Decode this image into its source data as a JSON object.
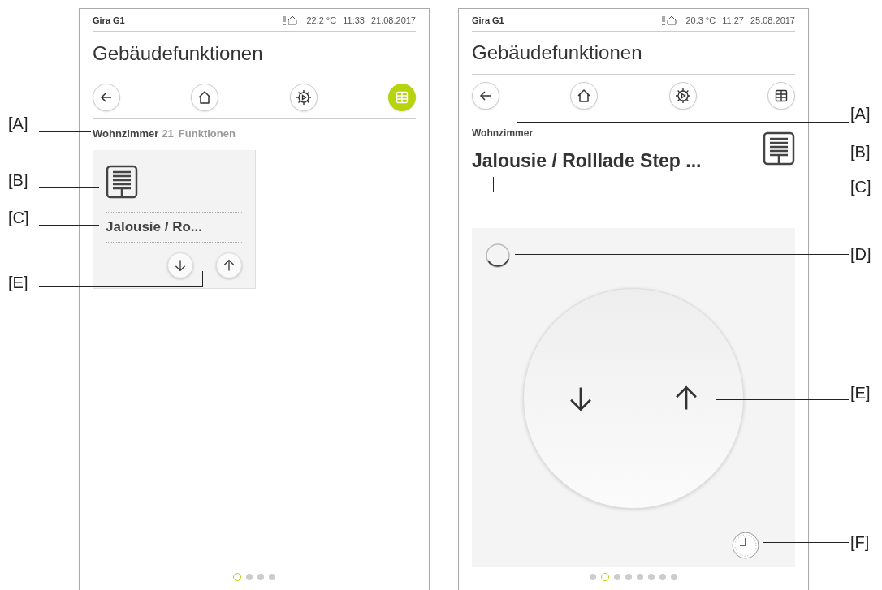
{
  "screens": [
    {
      "kind": "overview",
      "device": "Gira G1",
      "status": {
        "temperature": "22.2 °C",
        "time": "11:33",
        "date": "21.08.2017"
      },
      "title": "Gebäudefunktionen",
      "nav": [
        {
          "kind": "back",
          "selected": false
        },
        {
          "kind": "home",
          "selected": false
        },
        {
          "kind": "scenes",
          "selected": false
        },
        {
          "kind": "grid",
          "selected": true
        }
      ],
      "room": "Wohnzimmer",
      "count": "21",
      "count_label": "Funktionen",
      "tile": {
        "name": "Jalousie / Ro..."
      },
      "pages": [
        {
          "selected": true
        },
        {
          "selected": false
        },
        {
          "selected": false
        },
        {
          "selected": false
        }
      ],
      "callouts": [
        {
          "label": "[A]"
        },
        {
          "label": "[B]"
        },
        {
          "label": "[C]"
        },
        {
          "label": "[E]"
        }
      ]
    },
    {
      "kind": "detail",
      "device": "Gira G1",
      "status": {
        "temperature": "20.3 °C",
        "time": "11:27",
        "date": "25.08.2017"
      },
      "title": "Gebäudefunktionen",
      "nav": [
        {
          "kind": "back",
          "selected": false
        },
        {
          "kind": "home",
          "selected": false
        },
        {
          "kind": "scenes",
          "selected": false
        },
        {
          "kind": "grid",
          "selected": false
        }
      ],
      "room": "Wohnzimmer",
      "function_name": "Jalousie / Rolllade Step ...",
      "pages": [
        {
          "selected": false
        },
        {
          "selected": true
        },
        {
          "selected": false
        },
        {
          "selected": false
        },
        {
          "selected": false
        },
        {
          "selected": false
        },
        {
          "selected": false
        },
        {
          "selected": false
        }
      ],
      "callouts": [
        {
          "label": "[A]"
        },
        {
          "label": "[B]"
        },
        {
          "label": "[C]"
        },
        {
          "label": "[D]"
        },
        {
          "label": "[E]"
        },
        {
          "label": "[F]"
        }
      ]
    }
  ]
}
